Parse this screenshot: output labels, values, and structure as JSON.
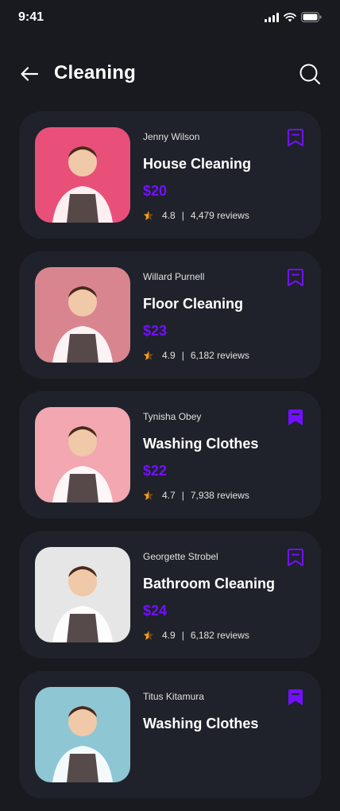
{
  "status": {
    "time": "9:41"
  },
  "header": {
    "title": "Cleaning"
  },
  "colors": {
    "accent": "#7210ff",
    "card_bg": "#1f222a",
    "page_bg": "#181a20",
    "star": "#ff9f1c"
  },
  "services": [
    {
      "provider": "Jenny Wilson",
      "title": "House Cleaning",
      "price": "$20",
      "rating": "4.8",
      "reviews": "4,479 reviews",
      "bookmarked": false,
      "thumb_bg": "#e8507a"
    },
    {
      "provider": "Willard Purnell",
      "title": "Floor Cleaning",
      "price": "$23",
      "rating": "4.9",
      "reviews": "6,182 reviews",
      "bookmarked": false,
      "thumb_bg": "#d98590"
    },
    {
      "provider": "Tynisha Obey",
      "title": "Washing Clothes",
      "price": "$22",
      "rating": "4.7",
      "reviews": "7,938 reviews",
      "bookmarked": true,
      "thumb_bg": "#f2a7b1"
    },
    {
      "provider": "Georgette Strobel",
      "title": "Bathroom Cleaning",
      "price": "$24",
      "rating": "4.9",
      "reviews": "6,182 reviews",
      "bookmarked": false,
      "thumb_bg": "#e6e6e6"
    },
    {
      "provider": "Titus Kitamura",
      "title": "Washing Clothes",
      "price": "",
      "rating": "",
      "reviews": "",
      "bookmarked": true,
      "thumb_bg": "#8fc6d4"
    }
  ]
}
